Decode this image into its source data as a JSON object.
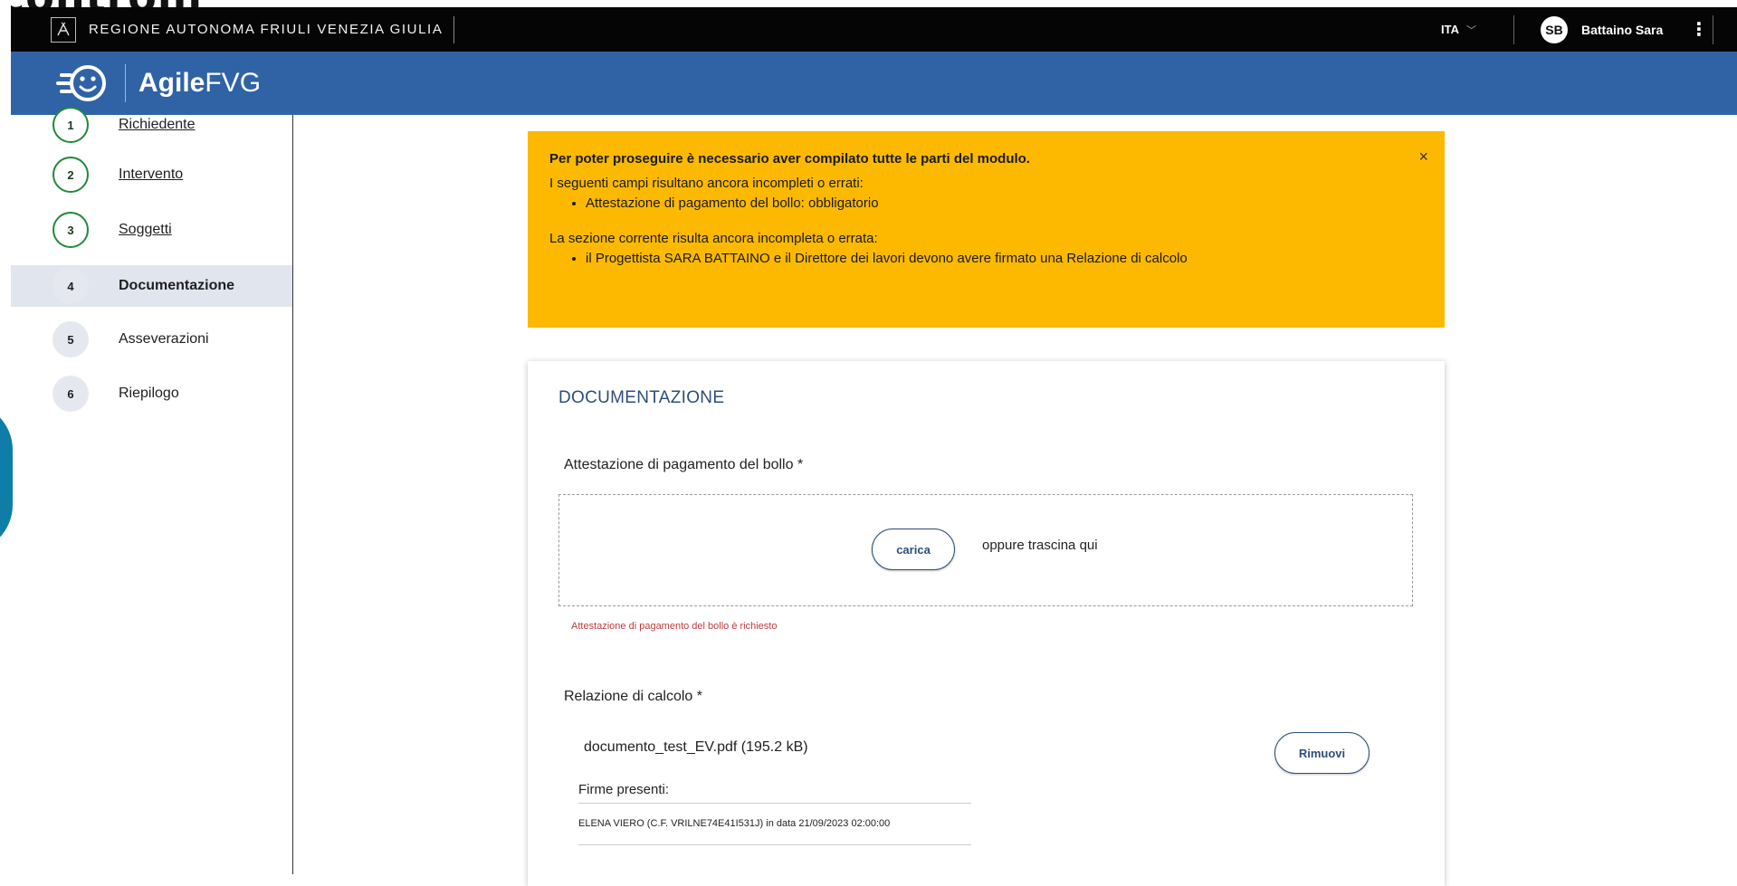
{
  "slide": {
    "title_fragment": "controlli"
  },
  "topbar": {
    "region_name": "REGIONE AUTONOMA FRIULI VENEZIA GIULIA",
    "language": "ITA",
    "user_initials": "SB",
    "user_name": "Battaino Sara"
  },
  "appbar": {
    "name_bold": "Agile",
    "name_regular": "FVG"
  },
  "sidebar": {
    "steps": [
      {
        "num": "1",
        "label": "Richiedente"
      },
      {
        "num": "2",
        "label": "Intervento"
      },
      {
        "num": "3",
        "label": "Soggetti"
      },
      {
        "num": "4",
        "label": "Documentazione"
      },
      {
        "num": "5",
        "label": "Asseverazioni"
      },
      {
        "num": "6",
        "label": "Riepilogo"
      }
    ]
  },
  "alert": {
    "title": "Per poter proseguire è necessario aver compilato tutte le parti del modulo.",
    "incomplete_intro": "I seguenti campi risultano ancora incompleti o errati:",
    "incomplete_items": [
      "Attestazione di pagamento del bollo: obbligatorio"
    ],
    "section_intro": "La sezione corrente risulta ancora incompleta o errata:",
    "section_items": [
      "il Progettista SARA BATTAINO e il Direttore dei lavori devono avere firmato una Relazione di calcolo"
    ],
    "close": "×"
  },
  "card": {
    "title": "DOCUMENTAZIONE",
    "bollo": {
      "label": "Attestazione di pagamento del bollo *",
      "upload_button": "carica",
      "drop_hint": "oppure trascina qui",
      "error": "Attestazione di pagamento del bollo è richiesto"
    },
    "calcolo": {
      "label": "Relazione di calcolo *",
      "file": "documento_test_EV.pdf (195.2 kB)",
      "remove_button": "Rimuovi",
      "signatures_title": "Firme presenti:",
      "signatures": [
        "ELENA VIERO (C.F. VRILNE74E41I531J) in data 21/09/2023 02:00:00"
      ]
    }
  },
  "colors": {
    "topbar": "#050505",
    "appbar": "#2f63a6",
    "alert": "#fcb900",
    "done_step": "#1f8a3a",
    "accent_text": "#2c4f7a",
    "error": "#c23b3b"
  }
}
